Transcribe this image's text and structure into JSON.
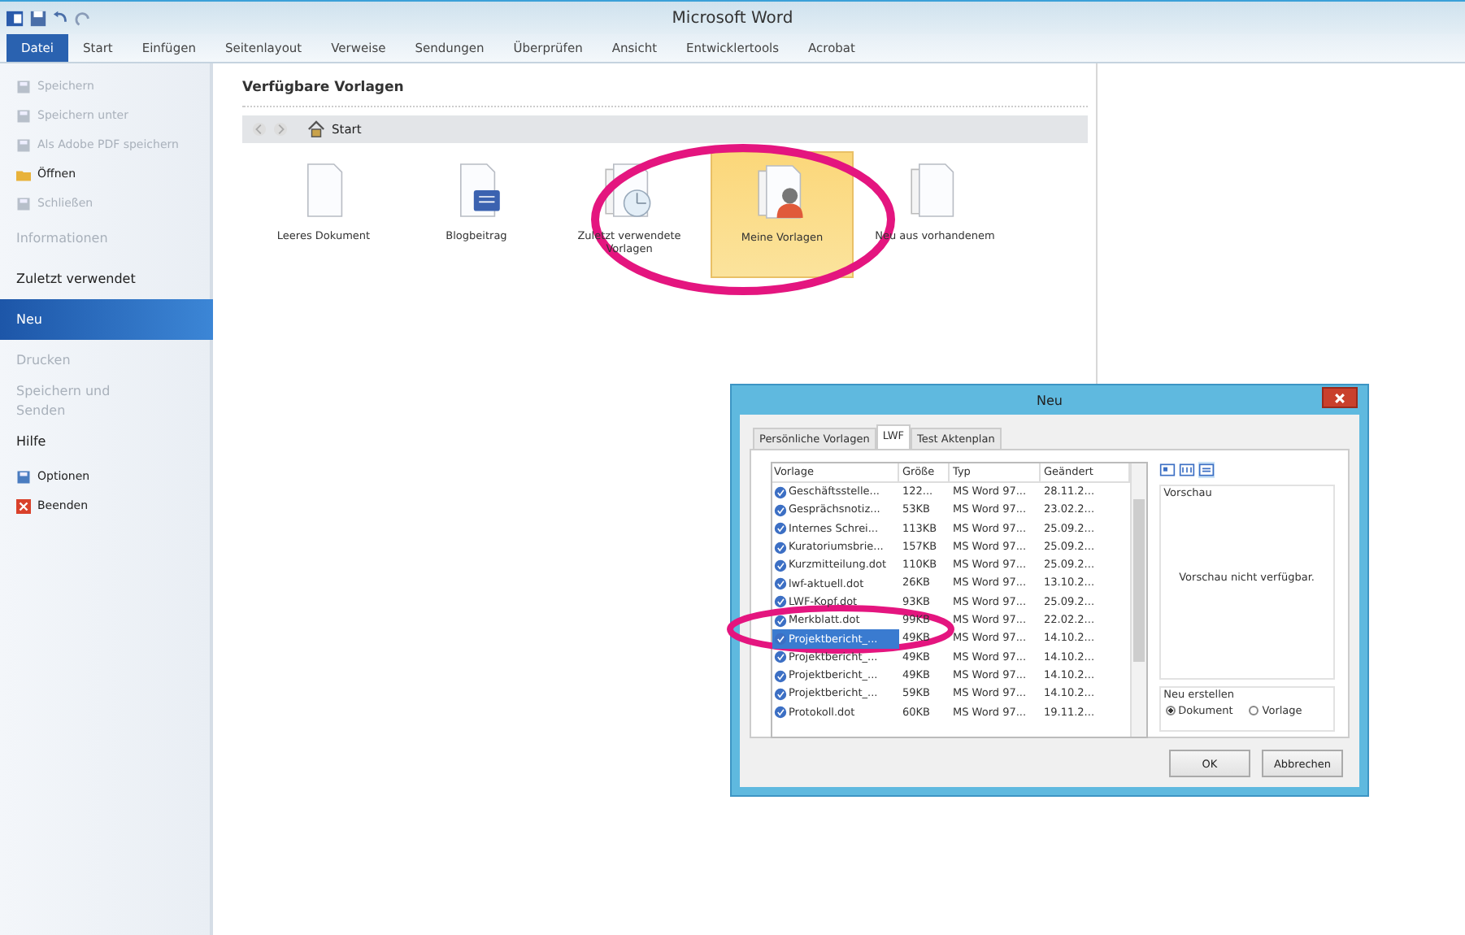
{
  "window": {
    "title": "Microsoft Word"
  },
  "ribbon_tabs": [
    {
      "label": "Datei",
      "selected": true
    },
    {
      "label": "Start",
      "selected": false
    },
    {
      "label": "Einfügen",
      "selected": false
    },
    {
      "label": "Seitenlayout",
      "selected": false
    },
    {
      "label": "Verweise",
      "selected": false
    },
    {
      "label": "Sendungen",
      "selected": false
    },
    {
      "label": "Überprüfen",
      "selected": false
    },
    {
      "label": "Ansicht",
      "selected": false
    },
    {
      "label": "Entwicklertools",
      "selected": false
    },
    {
      "label": "Acrobat",
      "selected": false
    }
  ],
  "backstage": [
    {
      "kind": "command",
      "label": "Speichern",
      "disabled": true,
      "selected": false
    },
    {
      "kind": "command",
      "label": "Speichern unter",
      "disabled": true,
      "selected": false
    },
    {
      "kind": "command",
      "label": "Als Adobe PDF speichern",
      "disabled": true,
      "selected": false
    },
    {
      "kind": "command",
      "label": "Öffnen",
      "disabled": false,
      "selected": false
    },
    {
      "kind": "command",
      "label": "Schließen",
      "disabled": true,
      "selected": false
    },
    {
      "kind": "section",
      "label": "Informationen",
      "disabled": true,
      "selected": false
    },
    {
      "kind": "section",
      "label": "Zuletzt verwendet",
      "disabled": false,
      "selected": false
    },
    {
      "kind": "section",
      "label": "Neu",
      "disabled": false,
      "selected": true
    },
    {
      "kind": "section",
      "label": "Drucken",
      "disabled": true,
      "selected": false
    },
    {
      "kind": "section",
      "label": "Speichern und Senden",
      "disabled": true,
      "selected": false
    },
    {
      "kind": "section",
      "label": "Hilfe",
      "disabled": false,
      "selected": false
    },
    {
      "kind": "command",
      "label": "Optionen",
      "disabled": false,
      "selected": false
    },
    {
      "kind": "command",
      "label": "Beenden",
      "disabled": false,
      "selected": false
    }
  ],
  "templates": {
    "heading": "Verfügbare Vorlagen",
    "breadcrumb": "Start",
    "items": [
      {
        "label": "Leeres Dokument",
        "selected": false
      },
      {
        "label": "Blogbeitrag",
        "selected": false
      },
      {
        "label": "Zuletzt verwendete Vorlagen",
        "selected": false
      },
      {
        "label": "Meine Vorlagen",
        "selected": true
      },
      {
        "label": "Neu aus vorhandenem",
        "selected": false
      }
    ]
  },
  "dialog": {
    "title": "Neu",
    "tabs": [
      {
        "label": "Persönliche Vorlagen",
        "selected": false
      },
      {
        "label": "LWF",
        "selected": true
      },
      {
        "label": "Test Aktenplan",
        "selected": false
      }
    ],
    "columns": [
      "Vorlage",
      "Größe",
      "Typ",
      "Geändert"
    ],
    "rows": [
      {
        "name": "Geschäftsstelle...",
        "size": "122...",
        "type": "MS Word 97...",
        "changed": "28.11.2...",
        "selected": false
      },
      {
        "name": "Gesprächsnotiz...",
        "size": "53KB",
        "type": "MS Word 97...",
        "changed": "23.02.2...",
        "selected": false
      },
      {
        "name": "Internes Schrei...",
        "size": "113KB",
        "type": "MS Word 97...",
        "changed": "25.09.2...",
        "selected": false
      },
      {
        "name": "Kuratoriumsbrie...",
        "size": "157KB",
        "type": "MS Word 97...",
        "changed": "25.09.2...",
        "selected": false
      },
      {
        "name": "Kurzmitteilung.dot",
        "size": "110KB",
        "type": "MS Word 97...",
        "changed": "25.09.2...",
        "selected": false
      },
      {
        "name": "lwf-aktuell.dot",
        "size": "26KB",
        "type": "MS Word 97...",
        "changed": "13.10.2...",
        "selected": false
      },
      {
        "name": "LWF-Kopf.dot",
        "size": "93KB",
        "type": "MS Word 97...",
        "changed": "25.09.2...",
        "selected": false
      },
      {
        "name": "Merkblatt.dot",
        "size": "99KB",
        "type": "MS Word 97...",
        "changed": "22.02.2...",
        "selected": false
      },
      {
        "name": "Projektbericht_...",
        "size": "49KB",
        "type": "MS Word 97...",
        "changed": "14.10.2...",
        "selected": true
      },
      {
        "name": "Projektbericht_...",
        "size": "49KB",
        "type": "MS Word 97...",
        "changed": "14.10.2...",
        "selected": false
      },
      {
        "name": "Projektbericht_...",
        "size": "49KB",
        "type": "MS Word 97...",
        "changed": "14.10.2...",
        "selected": false
      },
      {
        "name": "Projektbericht_...",
        "size": "59KB",
        "type": "MS Word 97...",
        "changed": "14.10.2...",
        "selected": false
      },
      {
        "name": "Protokoll.dot",
        "size": "60KB",
        "type": "MS Word 97...",
        "changed": "19.11.2...",
        "selected": false
      }
    ],
    "preview_label": "Vorschau",
    "preview_text": "Vorschau nicht verfügbar.",
    "create_label": "Neu erstellen",
    "create_options": [
      {
        "label": "Dokument",
        "selected": true
      },
      {
        "label": "Vorlage",
        "selected": false
      }
    ],
    "buttons": [
      "OK",
      "Abbrechen"
    ]
  }
}
